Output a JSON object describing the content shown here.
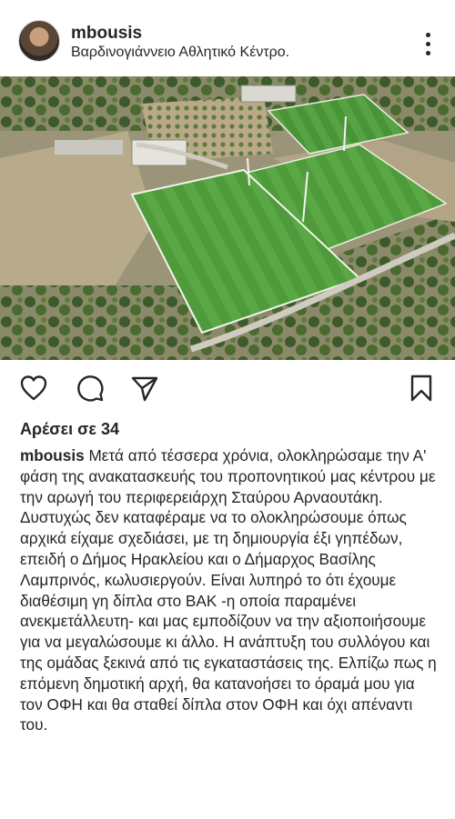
{
  "post": {
    "username": "mbousis",
    "location": "Βαρδινογιάννειο Αθλητικό Κέντρο.",
    "likes_text": "Αρέσει σε 34",
    "caption_user": "mbousis",
    "caption_text": "Μετά από τέσσερα χρόνια, ολοκληρώσαμε την Α' φάση της ανακατασκευής του προπονητικού μας κέντρου με την αρωγή του περιφερειάρχη Σταύρου Αρναουτάκη. Δυστυχώς δεν καταφέραμε να το ολοκληρώσουμε όπως αρχικά είχαμε σχεδιάσει, με τη δημιουργία έξι γηπέδων, επειδή ο Δήμος Ηρακλείου και ο Δήμαρχος Βασίλης Λαμπρινός, κωλυσιεργούν. Είναι λυπηρό το ότι έχουμε διαθέσιμη γη δίπλα στο ΒΑΚ -η οποία παραμένει ανεκμετάλλευτη- και μας εμποδίζουν να την αξιοποιήσουμε  για να μεγαλώσουμε κι άλλο. Η ανάπτυξη του συλλόγου και της ομάδας ξεκινά από τις εγκαταστάσεις της. Ελπίζω πως η επόμενη δημοτική αρχή, θα κατανοήσει το όραμά μου για τον ΟΦΗ και θα σταθεί δίπλα στον ΟΦΗ και όχι απέναντι του."
  },
  "icons": {
    "more": "more-options-icon",
    "like": "heart-icon",
    "comment": "comment-icon",
    "share": "send-icon",
    "save": "bookmark-icon"
  },
  "colors": {
    "text": "#262626",
    "background": "#ffffff"
  }
}
